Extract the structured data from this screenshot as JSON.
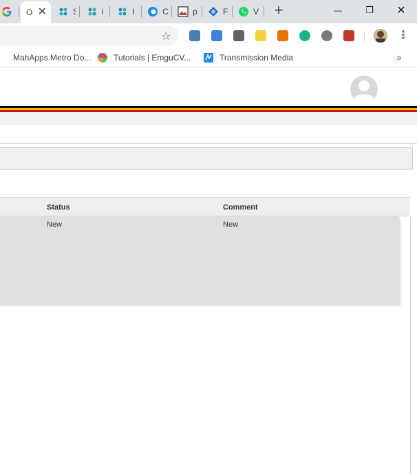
{
  "browser": {
    "tabs": [
      {
        "label": "c",
        "icon": "google-g-icon"
      },
      {
        "label": "O",
        "icon": "none",
        "active": true
      },
      {
        "label": "S",
        "icon": "sharepoint-icon"
      },
      {
        "label": "i",
        "icon": "sharepoint-icon"
      },
      {
        "label": "I",
        "icon": "sharepoint-icon"
      },
      {
        "label": "C",
        "icon": "c-logo-icon"
      },
      {
        "label": "p",
        "icon": "image-thumbnail-icon"
      },
      {
        "label": "F",
        "icon": "fluent-icon"
      },
      {
        "label": "V",
        "icon": "whatsapp-icon"
      }
    ],
    "new_tab_label": "+",
    "window_controls": {
      "minimize": "—",
      "restore": "❐",
      "close": "✕"
    },
    "bookmarks": [
      {
        "label": "MahApps.Metro Do...",
        "icon": "mahapps-icon"
      },
      {
        "label": "Tutorials | EmguCV...",
        "icon": "emgucv-icon"
      },
      {
        "label": "Transmission Media",
        "icon": "transmission-icon"
      }
    ],
    "bookmarks_more": "»",
    "extension_colors": [
      "#4a7fb5",
      "#3f7fe0",
      "#5f6368",
      "#f4d03f",
      "#e8710a",
      "#1fb085",
      "#7a7a7a",
      "#c0392b"
    ]
  },
  "app": {
    "accent_colors": {
      "black": "#000000",
      "yellow": "#f5c400",
      "red": "#d21010"
    },
    "grid": {
      "columns": [
        "Status",
        "Comment"
      ],
      "rows": [
        {
          "status": "New",
          "comment": "New"
        }
      ]
    }
  }
}
